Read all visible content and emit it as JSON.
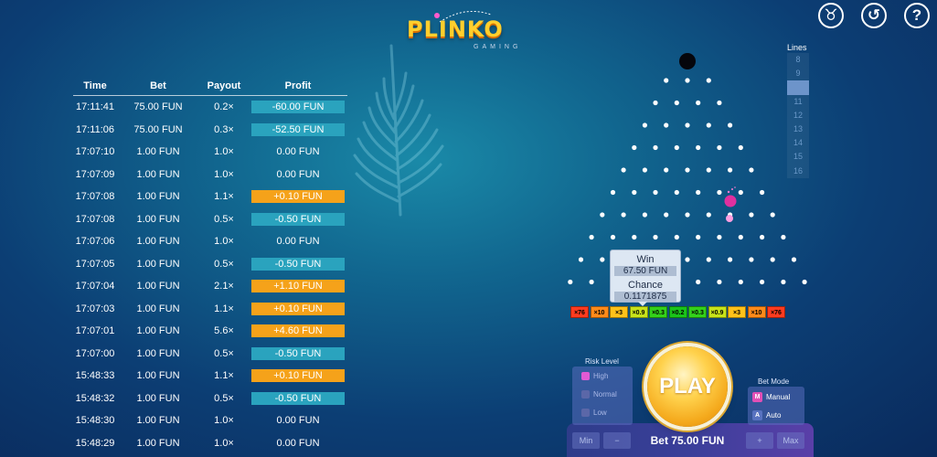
{
  "logo": {
    "title": "PLINKO",
    "subtitle": "GAMING"
  },
  "top_icons": [
    {
      "name": "trophy-icon",
      "glyph": "♉"
    },
    {
      "name": "history-icon",
      "glyph": "↺"
    },
    {
      "name": "help-icon",
      "glyph": "?"
    }
  ],
  "history": {
    "headers": {
      "time": "Time",
      "bet": "Bet",
      "payout": "Payout",
      "profit": "Profit"
    },
    "rows": [
      {
        "time": "17:11:41",
        "bet": "75.00 FUN",
        "payout": "0.2×",
        "profit": "-60.00 FUN",
        "kind": "neg"
      },
      {
        "time": "17:11:06",
        "bet": "75.00 FUN",
        "payout": "0.3×",
        "profit": "-52.50 FUN",
        "kind": "neg"
      },
      {
        "time": "17:07:10",
        "bet": "1.00 FUN",
        "payout": "1.0×",
        "profit": "0.00 FUN",
        "kind": "zero"
      },
      {
        "time": "17:07:09",
        "bet": "1.00 FUN",
        "payout": "1.0×",
        "profit": "0.00 FUN",
        "kind": "zero"
      },
      {
        "time": "17:07:08",
        "bet": "1.00 FUN",
        "payout": "1.1×",
        "profit": "+0.10 FUN",
        "kind": "pos"
      },
      {
        "time": "17:07:08",
        "bet": "1.00 FUN",
        "payout": "0.5×",
        "profit": "-0.50 FUN",
        "kind": "neg"
      },
      {
        "time": "17:07:06",
        "bet": "1.00 FUN",
        "payout": "1.0×",
        "profit": "0.00 FUN",
        "kind": "zero"
      },
      {
        "time": "17:07:05",
        "bet": "1.00 FUN",
        "payout": "0.5×",
        "profit": "-0.50 FUN",
        "kind": "neg"
      },
      {
        "time": "17:07:04",
        "bet": "1.00 FUN",
        "payout": "2.1×",
        "profit": "+1.10 FUN",
        "kind": "pos"
      },
      {
        "time": "17:07:03",
        "bet": "1.00 FUN",
        "payout": "1.1×",
        "profit": "+0.10 FUN",
        "kind": "pos"
      },
      {
        "time": "17:07:01",
        "bet": "1.00 FUN",
        "payout": "5.6×",
        "profit": "+4.60 FUN",
        "kind": "pos"
      },
      {
        "time": "17:07:00",
        "bet": "1.00 FUN",
        "payout": "0.5×",
        "profit": "-0.50 FUN",
        "kind": "neg"
      },
      {
        "time": "15:48:33",
        "bet": "1.00 FUN",
        "payout": "1.1×",
        "profit": "+0.10 FUN",
        "kind": "pos"
      },
      {
        "time": "15:48:32",
        "bet": "1.00 FUN",
        "payout": "0.5×",
        "profit": "-0.50 FUN",
        "kind": "neg"
      },
      {
        "time": "15:48:30",
        "bet": "1.00 FUN",
        "payout": "1.0×",
        "profit": "0.00 FUN",
        "kind": "zero"
      },
      {
        "time": "15:48:29",
        "bet": "1.00 FUN",
        "payout": "1.0×",
        "profit": "0.00 FUN",
        "kind": "zero"
      }
    ]
  },
  "lines": {
    "label": "Lines",
    "options": [
      "8",
      "9",
      "10",
      "11",
      "12",
      "13",
      "14",
      "15",
      "16"
    ],
    "selected": "10"
  },
  "board": {
    "rows": 10,
    "ball_color": "#e0309f",
    "peg_color": "#ffffff"
  },
  "multipliers": [
    {
      "label": "×76",
      "color": "#ff3b1f"
    },
    {
      "label": "×10",
      "color": "#ff8a1a"
    },
    {
      "label": "×3",
      "color": "#ffc21a"
    },
    {
      "label": "×0.9",
      "color": "#c7e31a"
    },
    {
      "label": "×0.3",
      "color": "#33d11a"
    },
    {
      "label": "×0.2",
      "color": "#1ac41a"
    },
    {
      "label": "×0.3",
      "color": "#33d11a"
    },
    {
      "label": "×0.9",
      "color": "#c7e31a"
    },
    {
      "label": "×3",
      "color": "#ffc21a"
    },
    {
      "label": "×10",
      "color": "#ff8a1a"
    },
    {
      "label": "×76",
      "color": "#ff3b1f"
    }
  ],
  "tooltip": {
    "win_label": "Win",
    "win_value": "67.50 FUN",
    "chance_label": "Chance",
    "chance_value": "0.1171875"
  },
  "controls": {
    "risk_label": "Risk Level",
    "risk_options": [
      "High",
      "Normal",
      "Low"
    ],
    "risk_selected": "High",
    "play_label": "PLAY",
    "bet_display": "Bet 75.00 FUN",
    "min_label": "Min",
    "minus_label": "−",
    "plus_label": "+",
    "max_label": "Max",
    "mode_label": "Bet Mode",
    "mode_options": [
      {
        "badge": "M",
        "label": "Manual",
        "active": true
      },
      {
        "badge": "A",
        "label": "Auto",
        "active": false
      }
    ]
  }
}
